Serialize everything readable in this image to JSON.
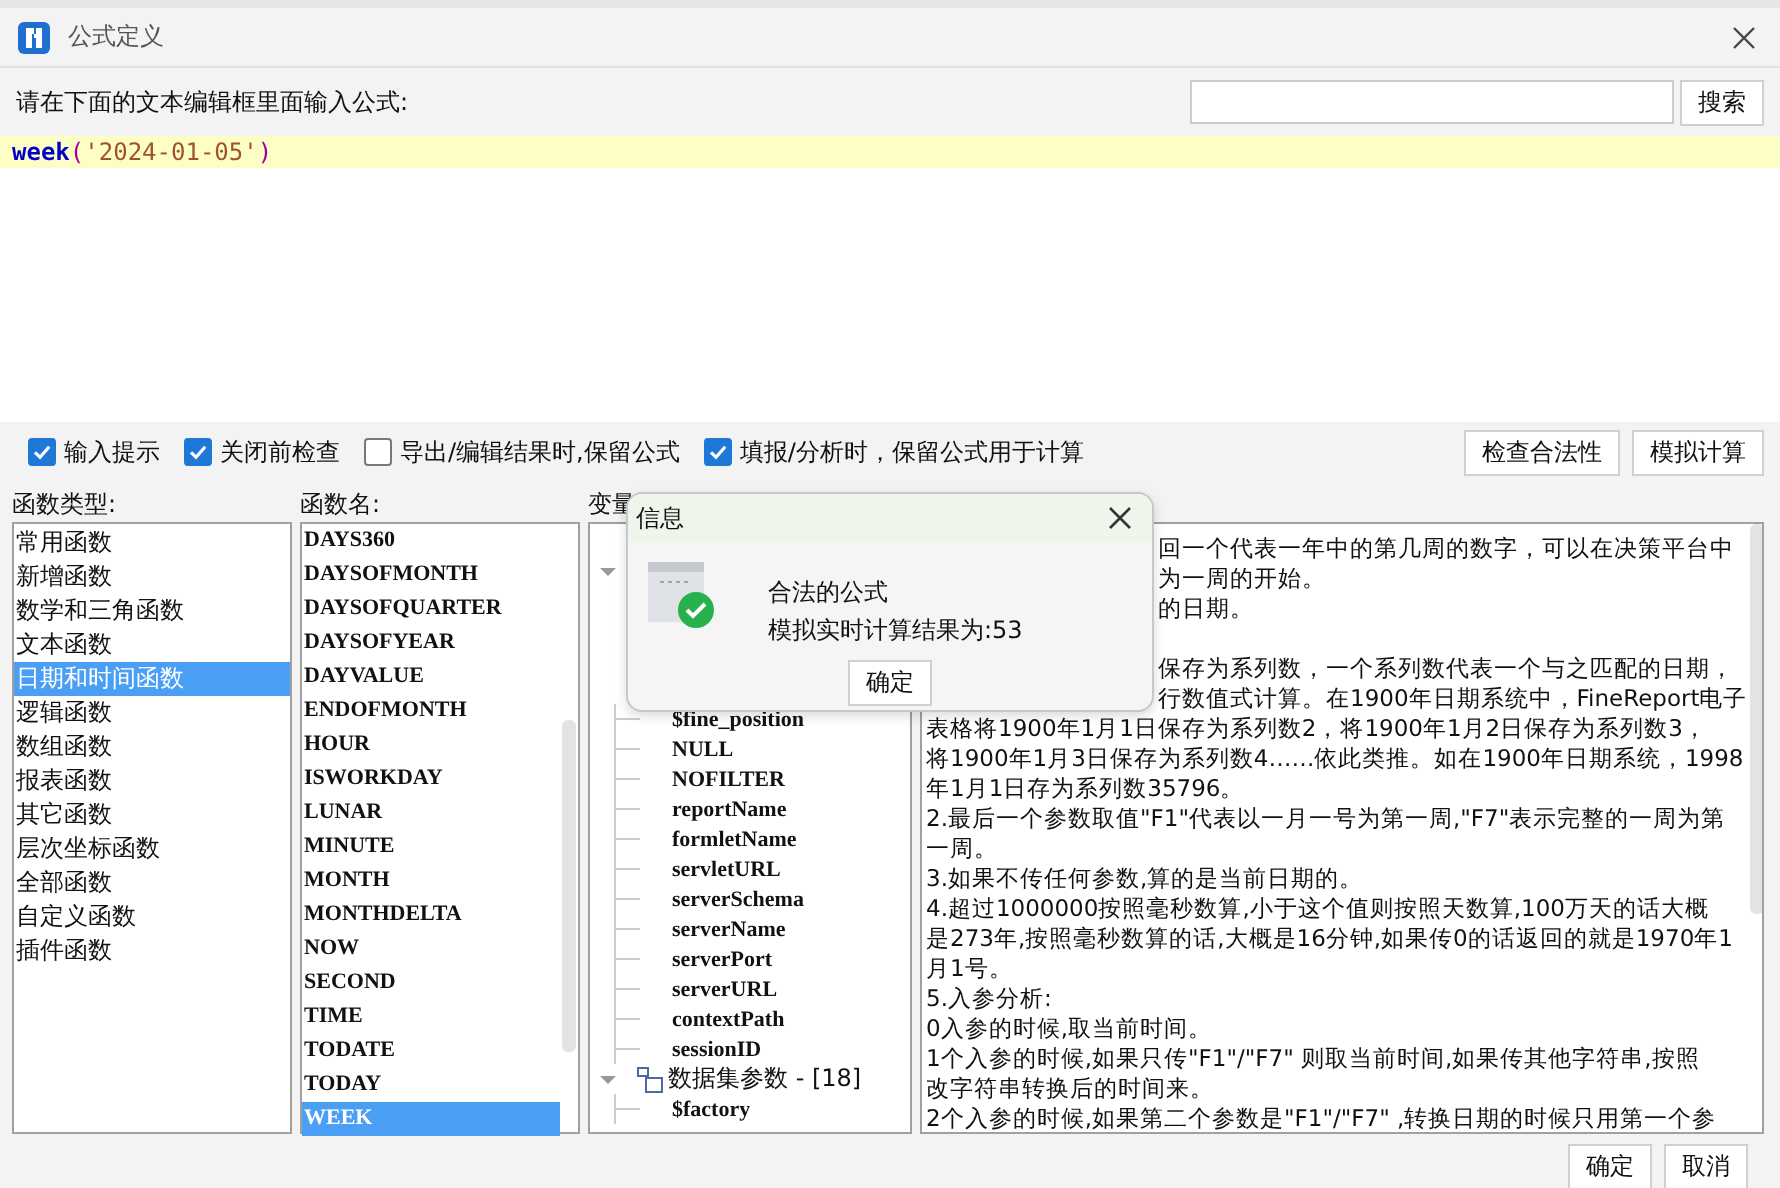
{
  "window": {
    "title": "公式定义"
  },
  "prompt": "请在下面的文本编辑框里面输入公式:",
  "search": {
    "button": "搜索"
  },
  "editor": {
    "tokens": [
      {
        "kind": "function",
        "text": "week"
      },
      {
        "kind": "paren",
        "text": "("
      },
      {
        "kind": "string",
        "text": "'2024-01-05'"
      },
      {
        "kind": "paren",
        "text": ")"
      }
    ]
  },
  "options": [
    {
      "label": "输入提示",
      "checked": true
    },
    {
      "label": "关闭前检查",
      "checked": true
    },
    {
      "label": "导出/编辑结果时,保留公式",
      "checked": false
    },
    {
      "label": "填报/分析时，保留公式用于计算",
      "checked": true
    }
  ],
  "actions": [
    "检查合法性",
    "模拟计算"
  ],
  "categories": {
    "heading": "函数类型:",
    "items": [
      {
        "label": "常用函数",
        "selected": false
      },
      {
        "label": "新增函数",
        "selected": false
      },
      {
        "label": "数学和三角函数",
        "selected": false
      },
      {
        "label": "文本函数",
        "selected": false
      },
      {
        "label": "日期和时间函数",
        "selected": true
      },
      {
        "label": "逻辑函数",
        "selected": false
      },
      {
        "label": "数组函数",
        "selected": false
      },
      {
        "label": "报表函数",
        "selected": false
      },
      {
        "label": "其它函数",
        "selected": false
      },
      {
        "label": "层次坐标函数",
        "selected": false
      },
      {
        "label": "全部函数",
        "selected": false
      },
      {
        "label": "自定义函数",
        "selected": false
      },
      {
        "label": "插件函数",
        "selected": false
      }
    ]
  },
  "functions": {
    "heading": "函数名:",
    "items": [
      {
        "label": "DAYS360",
        "selected": false
      },
      {
        "label": "DAYSOFMONTH",
        "selected": false
      },
      {
        "label": "DAYSOFQUARTER",
        "selected": false
      },
      {
        "label": "DAYSOFYEAR",
        "selected": false
      },
      {
        "label": "DAYVALUE",
        "selected": false
      },
      {
        "label": "ENDOFMONTH",
        "selected": false
      },
      {
        "label": "HOUR",
        "selected": false
      },
      {
        "label": "ISWORKDAY",
        "selected": false
      },
      {
        "label": "LUNAR",
        "selected": false
      },
      {
        "label": "MINUTE",
        "selected": false
      },
      {
        "label": "MONTH",
        "selected": false
      },
      {
        "label": "MONTHDELTA",
        "selected": false
      },
      {
        "label": "NOW",
        "selected": false
      },
      {
        "label": "SECOND",
        "selected": false
      },
      {
        "label": "TIME",
        "selected": false
      },
      {
        "label": "TODATE",
        "selected": false
      },
      {
        "label": "TODAY",
        "selected": false
      },
      {
        "label": "WEEK",
        "selected": true
      }
    ]
  },
  "variables": {
    "heading": "变量",
    "tree": [
      {
        "expanded": true,
        "children": [
          {
            "label": "$fine_position"
          },
          {
            "label": "NULL"
          },
          {
            "label": "NOFILTER"
          },
          {
            "label": "reportName"
          },
          {
            "label": "formletName"
          },
          {
            "label": "servletURL"
          },
          {
            "label": "serverSchema"
          },
          {
            "label": "serverName"
          },
          {
            "label": "serverPort"
          },
          {
            "label": "serverURL"
          },
          {
            "label": "contextPath"
          },
          {
            "label": "sessionID"
          }
        ]
      },
      {
        "label": "数据集参数 - [18]",
        "expanded": true,
        "children": [
          {
            "label": "$factory"
          }
        ]
      }
    ]
  },
  "description": {
    "covered_lines": [
      "回一个代表一年中的第几周的数字，可以在决策平台中",
      "为一周的开始。",
      "的日期。",
      "保存为系列数，一个系列数代表一个与之匹配的日期，",
      "行数值式计算。在1900年日期系统中，FineReport电子"
    ],
    "lines": [
      "表格将1900年1月1日保存为系列数2，将1900年1月2日保存为系列数3，",
      "将1900年1月3日保存为系列数4……依此类推。如在1900年日期系统，1998",
      "年1月1日存为系列数35796。",
      "2.最后一个参数取值\"F1\"代表以一月一号为第一周,\"F7\"表示完整的一周为第",
      "一周。",
      "3.如果不传任何参数,算的是当前日期的。",
      "4.超过1000000按照毫秒数算,小于这个值则按照天数算,100万天的话大概",
      "是273年,按照毫秒数算的话,大概是16分钟,如果传0的话返回的就是1970年1",
      "月1号。",
      "5.入参分析:",
      "0入参的时候,取当前时间。",
      "1个入参的时候,如果只传\"F1\"/\"F7\" 则取当前时间,如果传其他字符串,按照",
      "改字符串转换后的时间来。",
      "2个入参的时候,如果第二个参数是\"F1\"/\"F7\" ,转换日期的时候只用第一个参"
    ]
  },
  "popup": {
    "title": "信息",
    "lines": [
      "合法的公式",
      "模拟实时计算结果为:53"
    ],
    "button": "确定"
  },
  "footer": [
    "确定",
    "取消"
  ]
}
